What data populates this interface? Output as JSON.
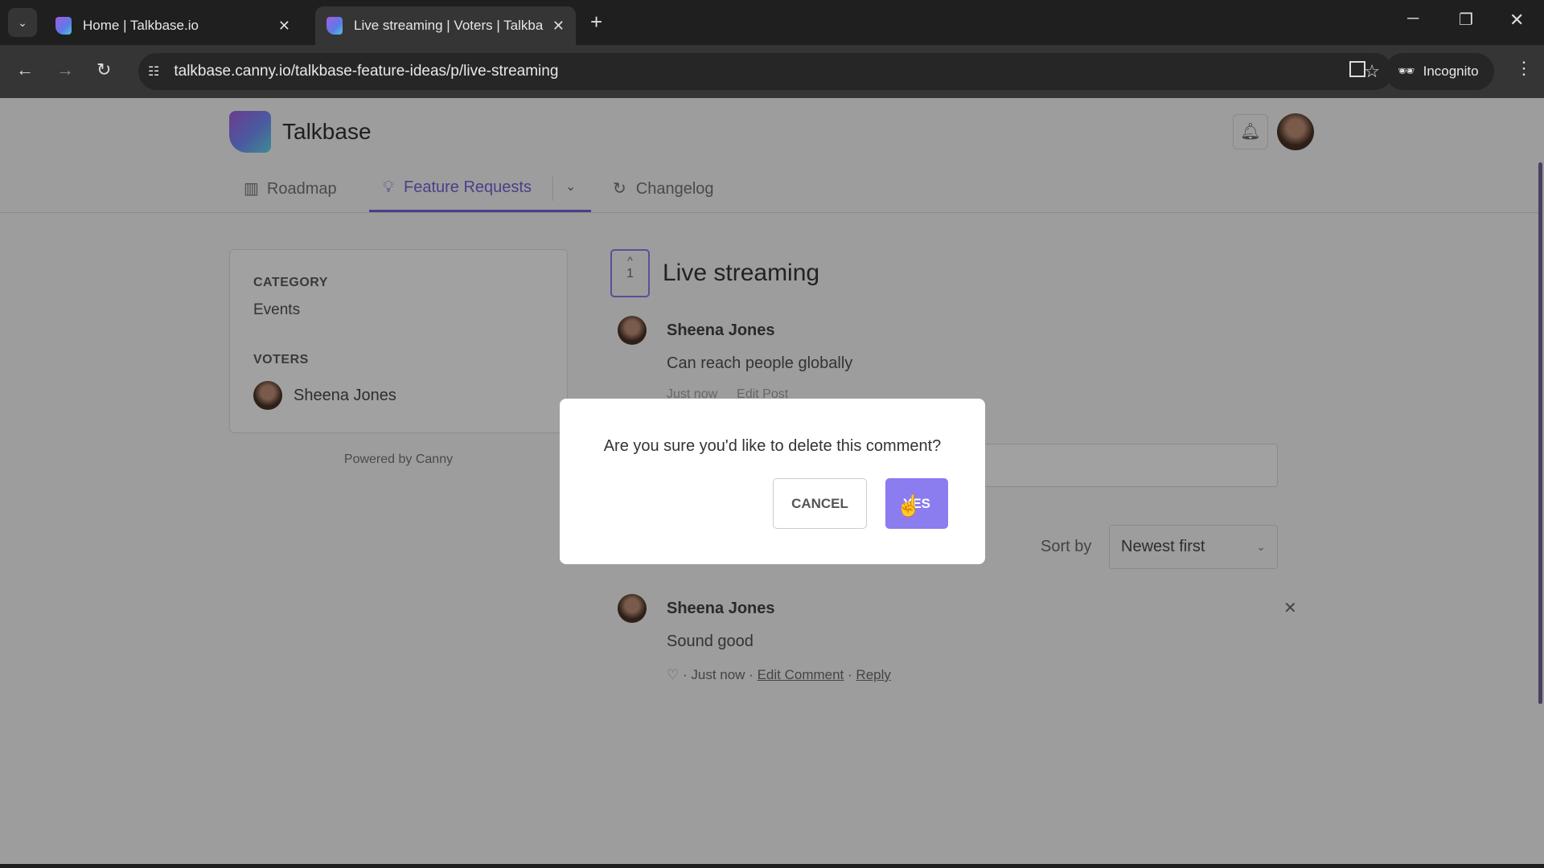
{
  "browser": {
    "tabs": [
      {
        "title": "Home | Talkbase.io"
      },
      {
        "title": "Live streaming | Voters | Talkba"
      }
    ],
    "url": "talkbase.canny.io/talkbase-feature-ideas/p/live-streaming",
    "incognito_label": "Incognito"
  },
  "header": {
    "brand": "Talkbase",
    "nav": [
      {
        "label": "Roadmap"
      },
      {
        "label": "Feature Requests"
      },
      {
        "label": "Changelog"
      }
    ]
  },
  "sidebar": {
    "category_heading": "CATEGORY",
    "category": "Events",
    "voters_heading": "VOTERS",
    "voters": [
      {
        "name": "Sheena Jones"
      }
    ],
    "powered_by": "Powered by Canny"
  },
  "post": {
    "vote_count": "1",
    "title": "Live streaming",
    "author": "Sheena Jones",
    "body": "Can reach people globally",
    "meta_time": "Just now",
    "edit_label": "Edit Post"
  },
  "sort": {
    "label": "Sort by",
    "value": "Newest first"
  },
  "comment": {
    "author": "Sheena Jones",
    "body": "Sound good",
    "time": "· Just now ·",
    "edit_label": "Edit Comment",
    "sep": "·",
    "reply_label": "Reply"
  },
  "modal": {
    "message": "Are you sure you'd like to delete this comment?",
    "cancel_label": "CANCEL",
    "yes_label": "YES"
  },
  "colors": {
    "accent": "#8b7cf0"
  }
}
